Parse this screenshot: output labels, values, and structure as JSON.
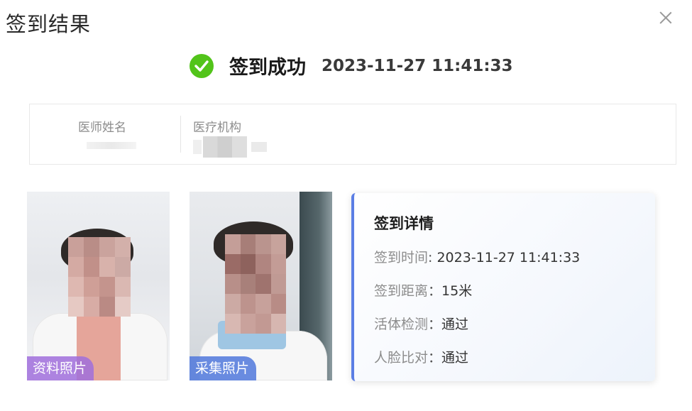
{
  "dialog": {
    "title": "签到结果",
    "close_icon": "close-icon"
  },
  "result": {
    "status_text": "签到成功",
    "timestamp": "2023-11-27  11:41:33",
    "status_color": "#52c41a"
  },
  "info": {
    "doctor_name_label": "医师姓名",
    "institution_label": "医疗机构"
  },
  "photos": {
    "profile_tag": "资料照片",
    "capture_tag": "采集照片"
  },
  "detail": {
    "title": "签到详情",
    "rows": [
      {
        "label": "签到时间",
        "sep": ": ",
        "value": "2023-11-27 11:41:33"
      },
      {
        "label": "签到距离",
        "sep": "：",
        "value": "15米"
      },
      {
        "label": "活体检测",
        "sep": "：",
        "value": "通过"
      },
      {
        "label": "人脸比对",
        "sep": "：",
        "value": "通过"
      }
    ],
    "accent_color": "#5b7ee5"
  }
}
